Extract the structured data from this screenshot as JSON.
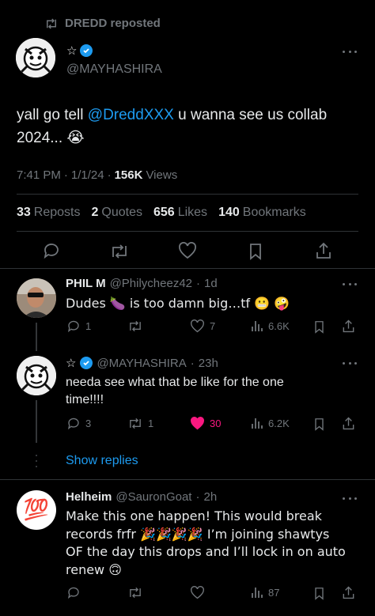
{
  "repost_header": {
    "text": "DREDD reposted"
  },
  "main_tweet": {
    "name_prefix": "☆",
    "handle": "@MAYHASHIRA",
    "text_before": "yall go tell ",
    "mention": "@DreddXXX",
    "text_after": " u wanna see us collab",
    "text_line2": "2024... ",
    "line2_emoji": "😭",
    "time": "7:41 PM",
    "date": "1/1/24",
    "views_count": "156K",
    "views_label": "Views",
    "stats": [
      {
        "count": "33",
        "label": "Reposts"
      },
      {
        "count": "2",
        "label": "Quotes"
      },
      {
        "count": "656",
        "label": "Likes"
      },
      {
        "count": "140",
        "label": "Bookmarks"
      }
    ]
  },
  "replies": [
    {
      "name": "PHIL M",
      "handle": "@Philycheez42",
      "age": "1d",
      "text": "Dudes 🍆 is too damn big…tf 😬 🤪",
      "replies": "1",
      "reposts": "",
      "likes": "7",
      "views": "6.6K"
    },
    {
      "name": "☆",
      "handle": "@MAYHASHIRA",
      "age": "23h",
      "text_line1": "needa see what that be like for the one",
      "text_line2": "time!!!!",
      "replies": "3",
      "reposts": "1",
      "likes": "30",
      "views": "6.2K"
    },
    {
      "name": "Helheim",
      "handle": "@SauronGoat",
      "age": "2h",
      "avatar_glyph": "💯",
      "text_line1": "Make this one happen! This would break",
      "text_line2": "records frfr 🎉🎉🎉🎉 I’m joining shawtys",
      "text_line3": "OF the day this drops and I’ll lock in on auto",
      "text_line4": "renew 🙃",
      "replies": "",
      "reposts": "",
      "likes": "",
      "views": "87"
    }
  ],
  "show_replies": {
    "label": "Show replies"
  },
  "colors": {
    "accent": "#1d9bf0",
    "like_active": "#f91880",
    "muted": "#71767b",
    "divider": "#2f3336"
  }
}
